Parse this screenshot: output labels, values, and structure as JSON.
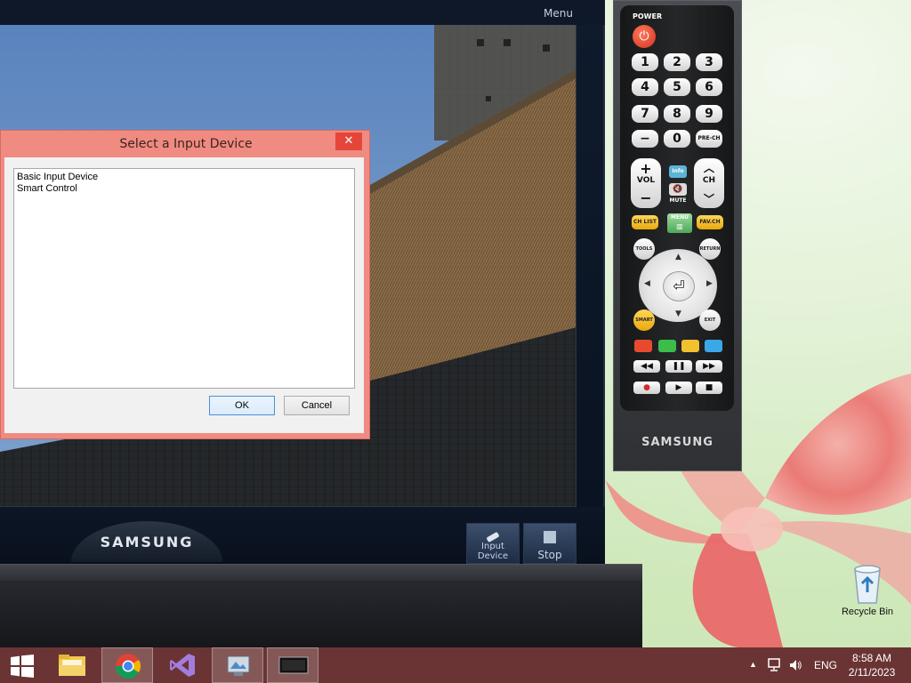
{
  "tv_viewer": {
    "menu_label": "Menu",
    "brand": "SAMSUNG",
    "buttons": [
      {
        "label": "Input Device",
        "icon": "usb-stick-icon"
      },
      {
        "label": "Stop",
        "icon": "stop-icon"
      }
    ]
  },
  "dialog": {
    "title": "Select a Input Device",
    "close_glyph": "✕",
    "devices": [
      "Basic Input Device",
      "Smart Control"
    ],
    "ok_label": "OK",
    "cancel_label": "Cancel",
    "accent": "#f08b82"
  },
  "remote": {
    "power_label": "POWER",
    "power_glyph": "⏻",
    "digits": [
      "1",
      "2",
      "3",
      "4",
      "5",
      "6",
      "7",
      "8",
      "9"
    ],
    "minus": "−",
    "zero": "0",
    "prech": "PRE-CH",
    "vol_top": "+",
    "vol_label": "VOL",
    "vol_bottom": "−",
    "info": "Info",
    "mute": "MUTE",
    "ch_top": "︿",
    "ch_label": "CH",
    "ch_bottom": "﹀",
    "chlist": "CH LIST",
    "menu": "MENU",
    "favch": "FAV.CH",
    "tools": "TOOLS",
    "return": "RETURN",
    "smart_hub": "SMART HUB",
    "exit": "EXIT",
    "color_keys": [
      "#e84a2f",
      "#3cbd4a",
      "#f2c12e",
      "#3aa8e8"
    ],
    "media_row1": [
      "◀◀",
      "❚❚",
      "▶▶"
    ],
    "media_row2": [
      "●",
      "▶",
      "■"
    ],
    "brand": "SAMSUNG"
  },
  "desktop": {
    "recycle_bin_label": "Recycle Bin"
  },
  "taskbar": {
    "color": "#6b3434",
    "items": [
      "windows-start-icon",
      "file-explorer-icon",
      "chrome-icon",
      "visual-studio-icon",
      "image-viewer-icon",
      "tv-viewer-icon"
    ],
    "tray_language": "ENG",
    "time": "8:58 AM",
    "date": "2/11/2023"
  }
}
